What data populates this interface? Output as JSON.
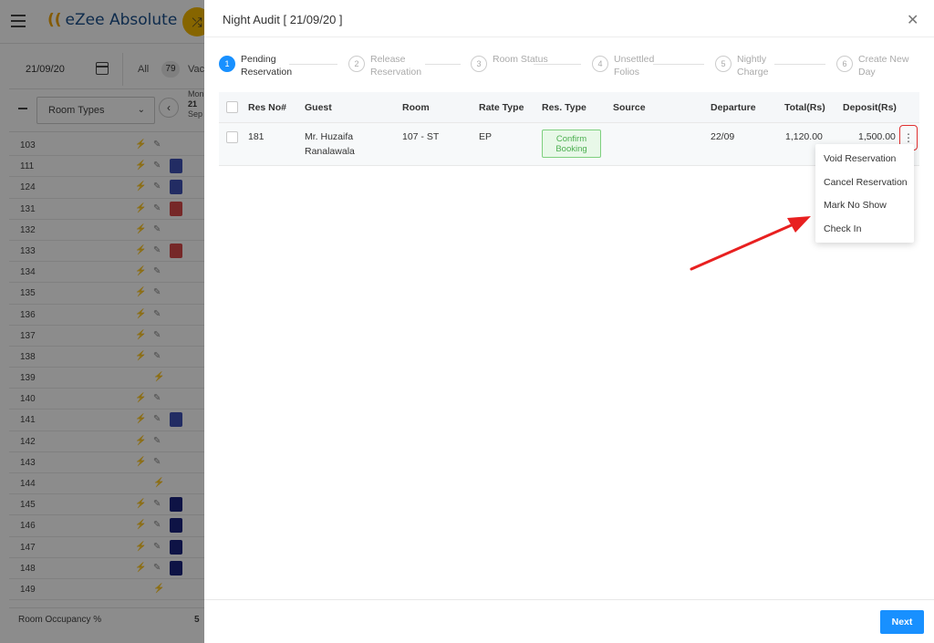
{
  "app": {
    "brand": "eZee Absolute",
    "date": "21/09/20",
    "all_label": "All",
    "all_count": "79",
    "vacant_label": "Vac",
    "room_types_label": "Room Types",
    "day": {
      "dow": "Mon",
      "date": "21",
      "month": "Sep"
    },
    "rooms": [
      "103",
      "111",
      "124",
      "131",
      "132",
      "133",
      "134",
      "135",
      "136",
      "137",
      "138",
      "139",
      "140",
      "141",
      "142",
      "143",
      "144",
      "145",
      "146",
      "147",
      "148",
      "149"
    ],
    "occupancy_label": "Room Occupancy %",
    "occupancy_value": "5"
  },
  "drawer": {
    "title": "Night Audit [ 21/09/20 ]",
    "steps": [
      {
        "num": "1",
        "line1": "Pending",
        "line2": "Reservation",
        "active": true
      },
      {
        "num": "2",
        "line1": "Release",
        "line2": "Reservation",
        "active": false
      },
      {
        "num": "3",
        "line1": "Room Status",
        "line2": "",
        "active": false
      },
      {
        "num": "4",
        "line1": "Unsettled",
        "line2": "Folios",
        "active": false
      },
      {
        "num": "5",
        "line1": "Nightly",
        "line2": "Charge",
        "active": false
      },
      {
        "num": "6",
        "line1": "Create New",
        "line2": "Day",
        "active": false
      }
    ],
    "columns": {
      "res_no": "Res No#",
      "guest": "Guest",
      "room": "Room",
      "rate_type": "Rate Type",
      "res_type": "Res. Type",
      "source": "Source",
      "departure": "Departure",
      "total": "Total(Rs)",
      "deposit": "Deposit(Rs)"
    },
    "row": {
      "res_no": "181",
      "guest_line1": "Mr. Huzaifa",
      "guest_line2": "Ranalawala",
      "room": "107 - ST",
      "rate_type": "EP",
      "res_type_line1": "Confirm",
      "res_type_line2": "Booking",
      "source": "",
      "departure": "22/09",
      "total": "1,120.00",
      "deposit": "1,500.00"
    },
    "menu": [
      "Void Reservation",
      "Cancel Reservation",
      "Mark No Show",
      "Check In"
    ],
    "next_label": "Next"
  },
  "colors": {
    "accent": "#1890ff",
    "highlight": "#e03030",
    "confirm_badge": "#4caf50"
  }
}
